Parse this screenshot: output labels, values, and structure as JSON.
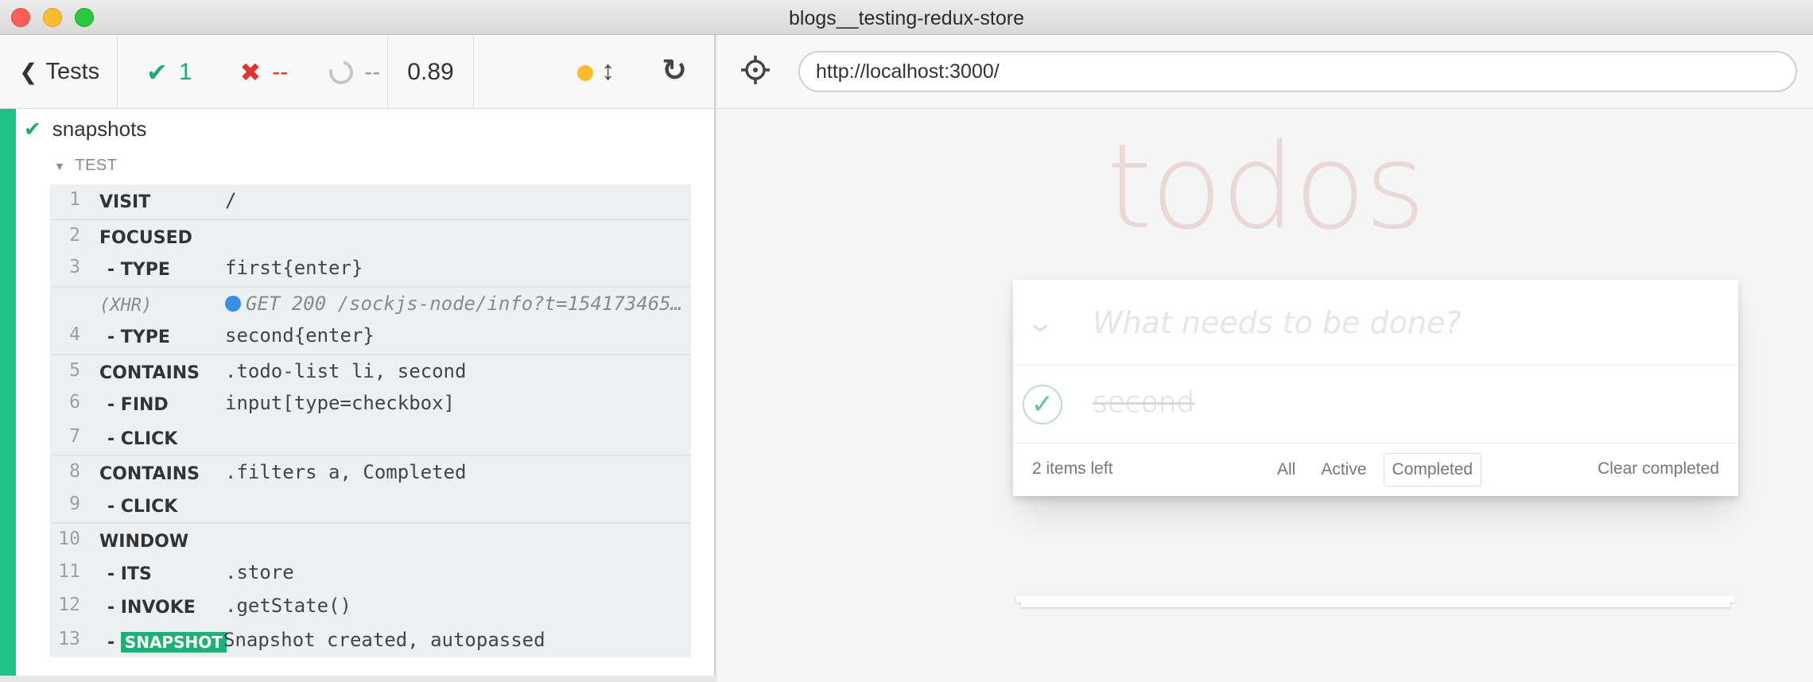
{
  "window": {
    "title": "blogs__testing-redux-store"
  },
  "reporter": {
    "back_label": "Tests",
    "passed": "1",
    "failed": "--",
    "pending": "--",
    "duration": "0.89",
    "suite_name": "snapshots",
    "test_label": "TEST",
    "commands": [
      {
        "num": "1",
        "name": "VISIT",
        "message": "/"
      },
      {
        "num": "2",
        "name": "FOCUSED",
        "message": ""
      },
      {
        "num": "3",
        "name": "- TYPE",
        "message": "first{enter}"
      },
      {
        "num": "",
        "name": "(XHR)",
        "message": "GET 200 /sockjs-node/info?t=154173465..."
      },
      {
        "num": "4",
        "name": "- TYPE",
        "message": "second{enter}"
      },
      {
        "num": "5",
        "name": "CONTAINS",
        "message": ".todo-list li, second"
      },
      {
        "num": "6",
        "name": "- FIND",
        "message": "input[type=checkbox]"
      },
      {
        "num": "7",
        "name": "- CLICK",
        "message": ""
      },
      {
        "num": "8",
        "name": "CONTAINS",
        "message": ".filters a, Completed"
      },
      {
        "num": "9",
        "name": "- CLICK",
        "message": ""
      },
      {
        "num": "10",
        "name": "WINDOW",
        "message": ""
      },
      {
        "num": "11",
        "name": "- ITS",
        "message": ".store"
      },
      {
        "num": "12",
        "name": "- INVOKE",
        "message": ".getState()"
      },
      {
        "num": "13",
        "name": "SNAPSHOT",
        "message": "Snapshot created, autopassed"
      }
    ]
  },
  "browser": {
    "url": "http://localhost:3000/"
  },
  "app": {
    "title": "todos",
    "new_todo_placeholder": "What needs to be done?",
    "todo_text": "second",
    "items_left": "2 items left",
    "filter_all": "All",
    "filter_active": "Active",
    "filter_completed": "Completed",
    "clear_completed": "Clear completed"
  },
  "colors": {
    "pass": "#1fc186",
    "fail": "#e2332e",
    "xhr_dot": "#3a8ee6",
    "indicator": "#fdbc2e"
  }
}
